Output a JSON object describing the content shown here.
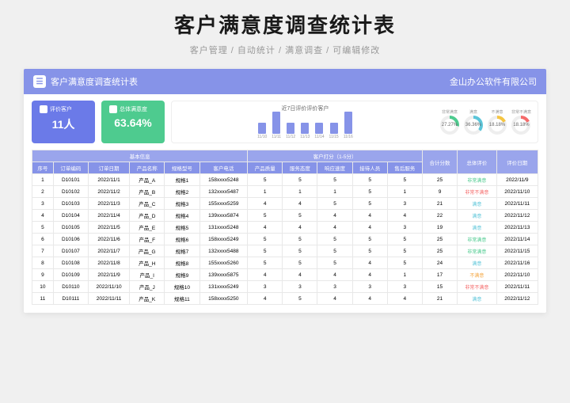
{
  "hero": {
    "title": "客户满意度调查统计表",
    "subtitle": "客户管理  /  自动统计  /  满意调查  /  可编辑修改"
  },
  "topbar": {
    "title": "客户满意度调查统计表",
    "company": "金山办公软件有限公司"
  },
  "cards": {
    "customers": {
      "label": "评价客户",
      "value": "11人"
    },
    "overall": {
      "label": "总体满意度",
      "value": "63.64%"
    }
  },
  "bar_chart": {
    "title": "近7日评价评价客户",
    "labels": [
      "11/10",
      "11/11",
      "11/12",
      "11/13",
      "11/14",
      "11/15",
      "11/16"
    ]
  },
  "chart_data": {
    "type": "bar",
    "categories": [
      "11/10",
      "11/11",
      "11/12",
      "11/13",
      "11/14",
      "11/15",
      "11/16"
    ],
    "values": [
      1,
      2,
      1,
      1,
      1,
      1,
      2
    ],
    "title": "近7日评价评价客户",
    "xlabel": "",
    "ylabel": "",
    "ylim": [
      0,
      3
    ],
    "donuts": [
      {
        "label": "非常满意",
        "value": 27.27,
        "color": "#4ecb8f"
      },
      {
        "label": "满意",
        "value": 36.36,
        "color": "#5bc5d9"
      },
      {
        "label": "不满意",
        "value": 18.18,
        "color": "#f5c542"
      },
      {
        "label": "非常不满意",
        "value": 18.18,
        "color": "#f56b6b"
      }
    ]
  },
  "donuts": [
    {
      "label": "非常满意",
      "pct": "27.27%",
      "cls": "green"
    },
    {
      "label": "满意",
      "pct": "36.36%",
      "cls": "teal"
    },
    {
      "label": "不满意",
      "pct": "18.18%",
      "cls": "yellow"
    },
    {
      "label": "非常不满意",
      "pct": "18.18%",
      "cls": "red"
    }
  ],
  "table": {
    "groups": {
      "basic": "基本信息",
      "scoring": "客户打分（1-5分）",
      "total": "合计分数",
      "overall": "总体评价",
      "date": "评价日期"
    },
    "headers": [
      "序号",
      "订单编码",
      "订单日期",
      "产品名称",
      "规格型号",
      "客户电话",
      "产品质量",
      "服务态度",
      "响应速度",
      "接待人员",
      "售后服务"
    ],
    "rows": [
      {
        "n": "1",
        "code": "D10101",
        "odate": "2022/11/1",
        "prod": "产品_A",
        "spec": "规格1",
        "phone": "158xxxx5248",
        "s": [
          5,
          5,
          5,
          5,
          5
        ],
        "sum": "25",
        "rating": "非常满意",
        "rcls": "r-vsat",
        "rdate": "2022/11/9"
      },
      {
        "n": "2",
        "code": "D10102",
        "odate": "2022/11/2",
        "prod": "产品_B",
        "spec": "规格2",
        "phone": "132xxxx5487",
        "s": [
          1,
          1,
          1,
          5,
          1
        ],
        "sum": "9",
        "rating": "非常不满意",
        "rcls": "r-vunsat",
        "rdate": "2022/11/10"
      },
      {
        "n": "3",
        "code": "D10103",
        "odate": "2022/11/3",
        "prod": "产品_C",
        "spec": "规格3",
        "phone": "155xxxx5259",
        "s": [
          4,
          4,
          5,
          5,
          3
        ],
        "sum": "21",
        "rating": "满意",
        "rcls": "r-sat",
        "rdate": "2022/11/11"
      },
      {
        "n": "4",
        "code": "D10104",
        "odate": "2022/11/4",
        "prod": "产品_D",
        "spec": "规格4",
        "phone": "139xxxx5874",
        "s": [
          5,
          5,
          4,
          4,
          4
        ],
        "sum": "22",
        "rating": "满意",
        "rcls": "r-sat",
        "rdate": "2022/11/12"
      },
      {
        "n": "5",
        "code": "D10105",
        "odate": "2022/11/5",
        "prod": "产品_E",
        "spec": "规格5",
        "phone": "131xxxx5248",
        "s": [
          4,
          4,
          4,
          4,
          3
        ],
        "sum": "19",
        "rating": "满意",
        "rcls": "r-sat",
        "rdate": "2022/11/13"
      },
      {
        "n": "6",
        "code": "D10106",
        "odate": "2022/11/6",
        "prod": "产品_F",
        "spec": "规格6",
        "phone": "158xxxx5249",
        "s": [
          5,
          5,
          5,
          5,
          5
        ],
        "sum": "25",
        "rating": "非常满意",
        "rcls": "r-vsat",
        "rdate": "2022/11/14"
      },
      {
        "n": "7",
        "code": "D10107",
        "odate": "2022/11/7",
        "prod": "产品_G",
        "spec": "规格7",
        "phone": "132xxxx5488",
        "s": [
          5,
          5,
          5,
          5,
          5
        ],
        "sum": "25",
        "rating": "非常满意",
        "rcls": "r-vsat",
        "rdate": "2022/11/15"
      },
      {
        "n": "8",
        "code": "D10108",
        "odate": "2022/11/8",
        "prod": "产品_H",
        "spec": "规格8",
        "phone": "155xxxx5260",
        "s": [
          5,
          5,
          5,
          4,
          5
        ],
        "sum": "24",
        "rating": "满意",
        "rcls": "r-sat",
        "rdate": "2022/11/16"
      },
      {
        "n": "9",
        "code": "D10109",
        "odate": "2022/11/9",
        "prod": "产品_I",
        "spec": "规格9",
        "phone": "139xxxx5875",
        "s": [
          4,
          4,
          4,
          4,
          1
        ],
        "sum": "17",
        "rating": "不满意",
        "rcls": "r-unsat",
        "rdate": "2022/11/10"
      },
      {
        "n": "10",
        "code": "D10110",
        "odate": "2022/11/10",
        "prod": "产品_J",
        "spec": "规格10",
        "phone": "131xxxx5249",
        "s": [
          3,
          3,
          3,
          3,
          3
        ],
        "sum": "15",
        "rating": "非常不满意",
        "rcls": "r-vunsat",
        "rdate": "2022/11/11"
      },
      {
        "n": "11",
        "code": "D10111",
        "odate": "2022/11/11",
        "prod": "产品_K",
        "spec": "规格11",
        "phone": "158xxxx5250",
        "s": [
          4,
          5,
          4,
          4,
          4
        ],
        "sum": "21",
        "rating": "满意",
        "rcls": "r-sat",
        "rdate": "2022/11/12"
      }
    ]
  }
}
